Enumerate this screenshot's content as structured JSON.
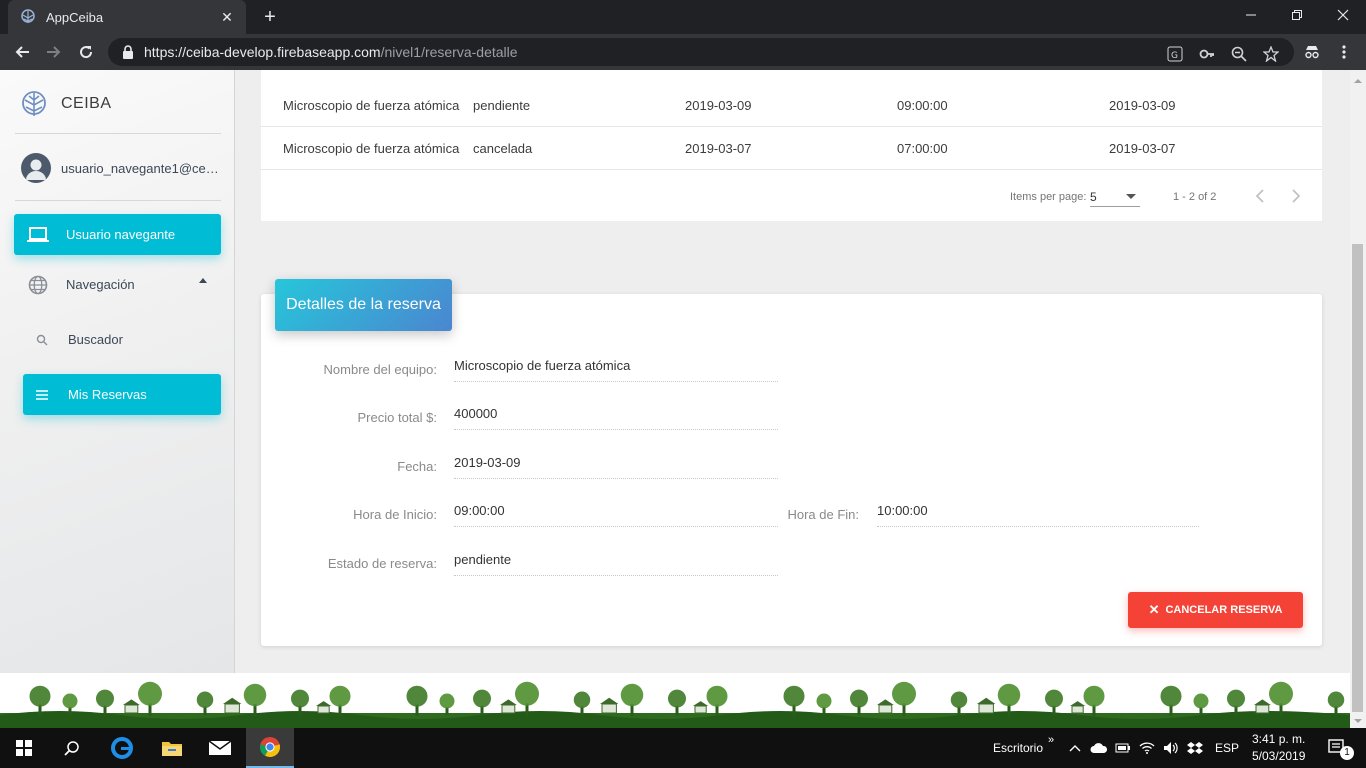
{
  "browser": {
    "tab_title": "AppCeiba",
    "tab_close": "✕",
    "new_tab": "+",
    "url_host": "https://ceiba-develop.firebaseapp.com",
    "url_path": "/nivel1/reserva-detalle"
  },
  "sidebar": {
    "brand": "CEIBA",
    "user_email": "usuario_navegante1@ceiba.com.co",
    "items": [
      {
        "label": "Usuario navegante",
        "icon": "laptop-icon"
      },
      {
        "label": "Navegación",
        "icon": "globe-icon"
      },
      {
        "label": "Buscador",
        "icon": "search-icon"
      },
      {
        "label": "Mis Reservas",
        "icon": "list-icon"
      }
    ]
  },
  "table": {
    "rows": [
      [
        "Microscopio de fuerza atómica",
        "pendiente",
        "2019-03-09",
        "09:00:00",
        "2019-03-09"
      ],
      [
        "Microscopio de fuerza atómica",
        "cancelada",
        "2019-03-07",
        "07:00:00",
        "2019-03-07"
      ]
    ]
  },
  "paginator": {
    "items_per_page_label": "Items per page:",
    "page_size": "5",
    "range": "1 - 2 of 2"
  },
  "detail": {
    "header": "Detalles de la reserva",
    "nombre_label": "Nombre del equipo:",
    "nombre_value": "Microscopio de fuerza atómica",
    "precio_label": "Precio total $:",
    "precio_value": "400000",
    "fecha_label": "Fecha:",
    "fecha_value": "2019-03-09",
    "hora_inicio_label": "Hora de Inicio:",
    "hora_inicio_value": "09:00:00",
    "hora_fin_label": "Hora de Fin:",
    "hora_fin_value": "10:00:00",
    "estado_label": "Estado de reserva:",
    "estado_value": "pendiente",
    "cancel_button": "CANCELAR RESERVA"
  },
  "taskbar": {
    "escritorio": "Escritorio",
    "language": "ESP",
    "time": "3:41 p. m.",
    "date": "5/03/2019",
    "notification_count": "1"
  },
  "colors": {
    "accent": "#00bcd4",
    "danger": "#f44336",
    "header_gradient_start": "#26c6da",
    "header_gradient_end": "#4b86d0"
  }
}
